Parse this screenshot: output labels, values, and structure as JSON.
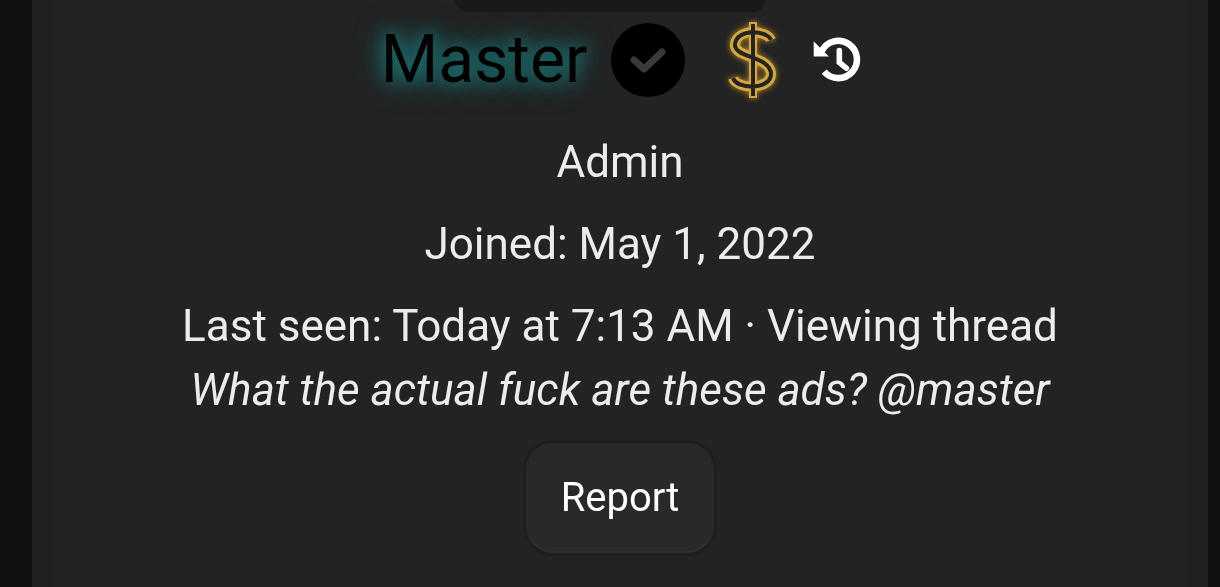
{
  "profile": {
    "name": "Master",
    "title": "Admin",
    "joined": "Joined: May 1, 2022",
    "last_seen": "Last seen: Today at 7:13 AM · Viewing thread",
    "status": "What the actual fuck are these ads? @master"
  },
  "buttons": [
    "Report"
  ]
}
